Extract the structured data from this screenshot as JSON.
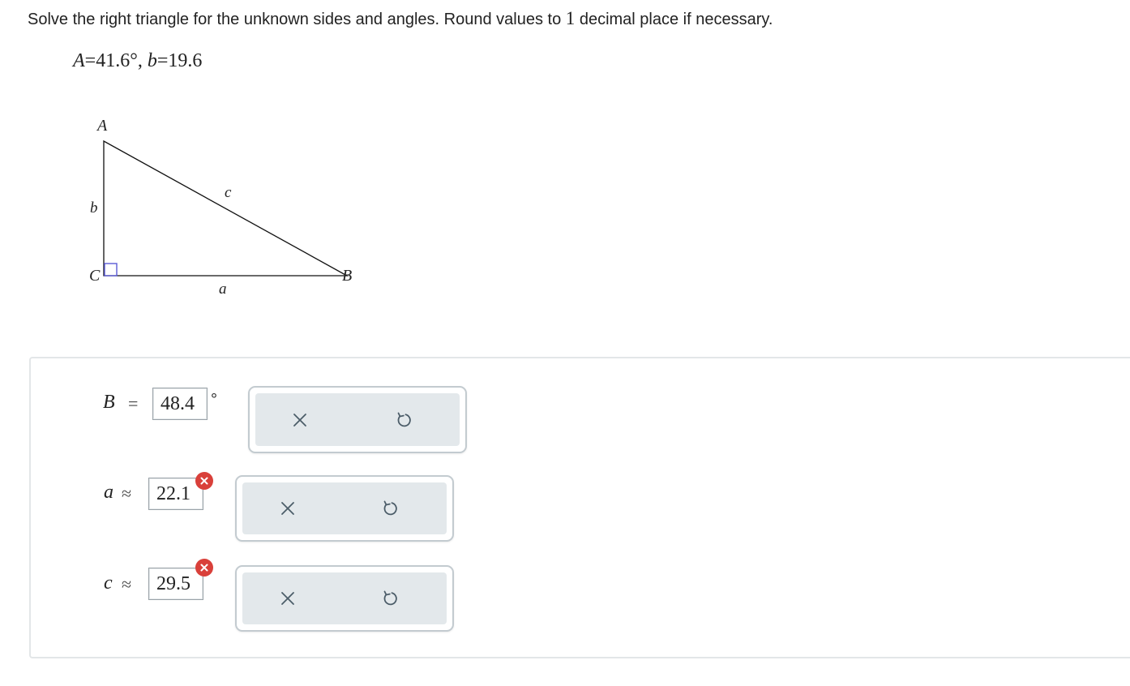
{
  "question": {
    "text_before": "Solve the right triangle for the unknown sides and angles. Round values to",
    "decimal_places": "1",
    "text_after": "decimal place if necessary."
  },
  "given": {
    "angle_label": "A",
    "equals": "=",
    "angle_value": "41.6°",
    "separator": ",",
    "side_label": "b",
    "side_value": "19.6"
  },
  "triangle": {
    "vertex_a": "A",
    "vertex_b": "B",
    "vertex_c": "C",
    "side_a": "a",
    "side_b": "b",
    "side_c": "c"
  },
  "answers": [
    {
      "variable": "B",
      "relation": "=",
      "value": "48.4",
      "unit": "°",
      "status": "unmarked"
    },
    {
      "variable": "a",
      "relation": "≈",
      "value": "22.1",
      "unit": "",
      "status": "incorrect"
    },
    {
      "variable": "c",
      "relation": "≈",
      "value": "29.5",
      "unit": "",
      "status": "incorrect"
    }
  ],
  "colors": {
    "incorrect_badge": "#d9403a",
    "tool_background": "#e3e8eb",
    "icon": "#4c5d69",
    "right_angle_marker": "#5b5bd6"
  },
  "icons": {
    "clear": "close-x-icon",
    "undo": "undo-arrow-icon",
    "incorrect": "x-circle-icon"
  }
}
